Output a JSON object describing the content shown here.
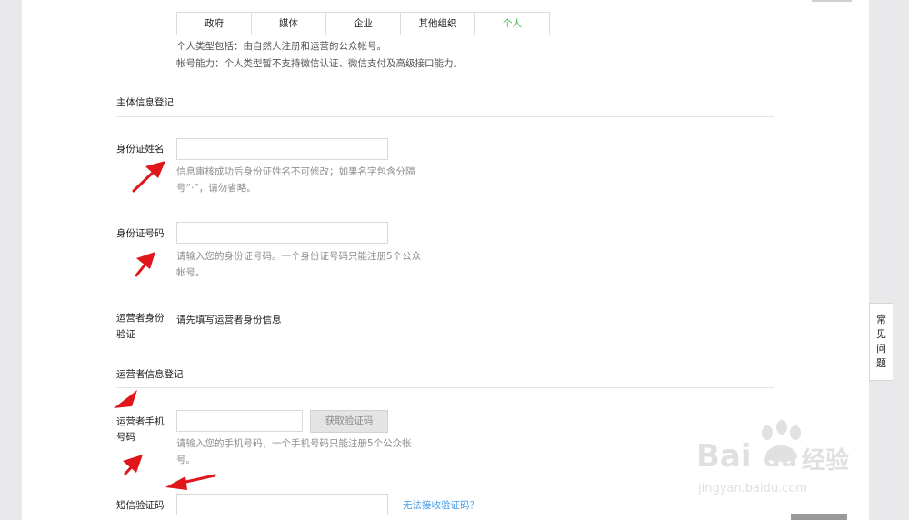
{
  "tabs": [
    "政府",
    "媒体",
    "企业",
    "其他组织",
    "个人"
  ],
  "personal_type_note": "个人类型包括：由自然人注册和运营的公众帐号。",
  "account_ability_note": "帐号能力：个人类型暂不支持微信认证、微信支付及高级接口能力。",
  "subject_section_title": "主体信息登记",
  "id_name": {
    "label": "身份证姓名",
    "value": "",
    "hint_line1": "信息审核成功后身份证姓名不可修改；如果名字包含分隔",
    "hint_line2": "号“·”，请勿省略。"
  },
  "id_number": {
    "label": "身份证号码",
    "value": "",
    "hint_line1": "请输入您的身份证号码。一个身份证号码只能注册5个公众",
    "hint_line2": "帐号。"
  },
  "operator_verify": {
    "label_line1": "运营者身份",
    "label_line2": "验证",
    "value": "请先填写运营者身份信息"
  },
  "operator_section_title": "运营者信息登记",
  "phone": {
    "label_line1": "运营者手机",
    "label_line2": "号码",
    "value": "",
    "get_code_button": "获取验证码",
    "hint_line1": "请输入您的手机号码，一个手机号码只能注册5个公众帐",
    "hint_line2": "号。"
  },
  "sms": {
    "label": "短信验证码",
    "value": "",
    "cannot_receive_link": "无法接收验证码？"
  },
  "faq": [
    "常",
    "见",
    "问",
    "题"
  ],
  "watermark": {
    "brand": "Bai",
    "brand2": "du",
    "cn": "经验",
    "url": "jingyan.baidu.com"
  },
  "colors": {
    "active_tab": "#44b549",
    "link": "#459ae9",
    "arrow": "#e0161b"
  }
}
